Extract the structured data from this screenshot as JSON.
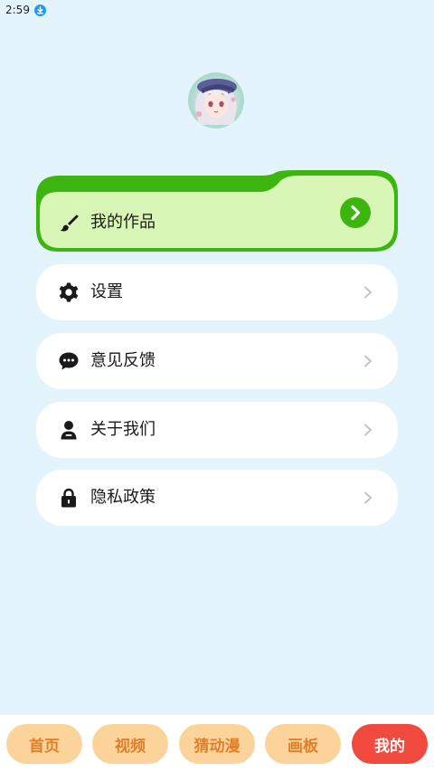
{
  "status_bar": {
    "time": "2:59"
  },
  "menu": {
    "works_label": "我的作品",
    "items": [
      {
        "label": "设置",
        "icon": "gear-icon"
      },
      {
        "label": "意见反馈",
        "icon": "chat-bubble-icon"
      },
      {
        "label": "关于我们",
        "icon": "person-icon"
      },
      {
        "label": "隐私政策",
        "icon": "lock-icon"
      }
    ]
  },
  "bottom_nav": {
    "tabs": [
      "首页",
      "视频",
      "猜动漫",
      "画板",
      "我的"
    ],
    "active_index": 4
  },
  "colors": {
    "background": "#e4f4fd",
    "accent_green": "#3db510",
    "works_card_fill": "#d8f7b6",
    "nav_tab": "#fcd49b",
    "nav_tab_text": "#e0802b",
    "nav_active": "#f04a3e"
  }
}
